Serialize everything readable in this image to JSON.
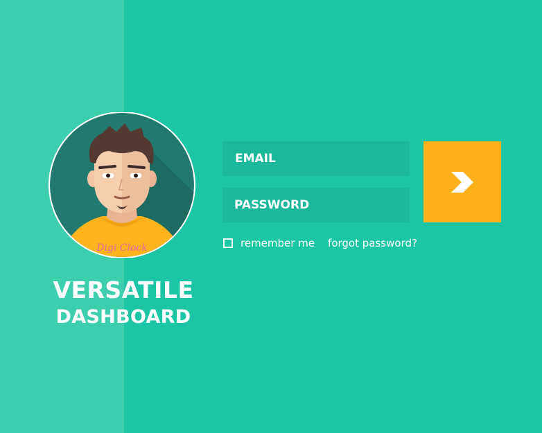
{
  "colors": {
    "background": "#1cc5a3",
    "side_panel": "#3dcfad",
    "input_fill": "#1bb89a",
    "submit": "#fcb11b",
    "text": "#ffffff"
  },
  "avatar": {
    "watermark_text": "Digi Clock",
    "icon": "user-avatar-illustration"
  },
  "brand": {
    "line1": "VERSATILE",
    "line2": "DASHBOARD"
  },
  "login": {
    "email_placeholder": "EMAIL",
    "password_placeholder": "PASSWORD",
    "submit_icon": "chevron-right-icon",
    "remember_label": "remember me",
    "remember_checked": false,
    "forgot_label": "forgot password?"
  }
}
